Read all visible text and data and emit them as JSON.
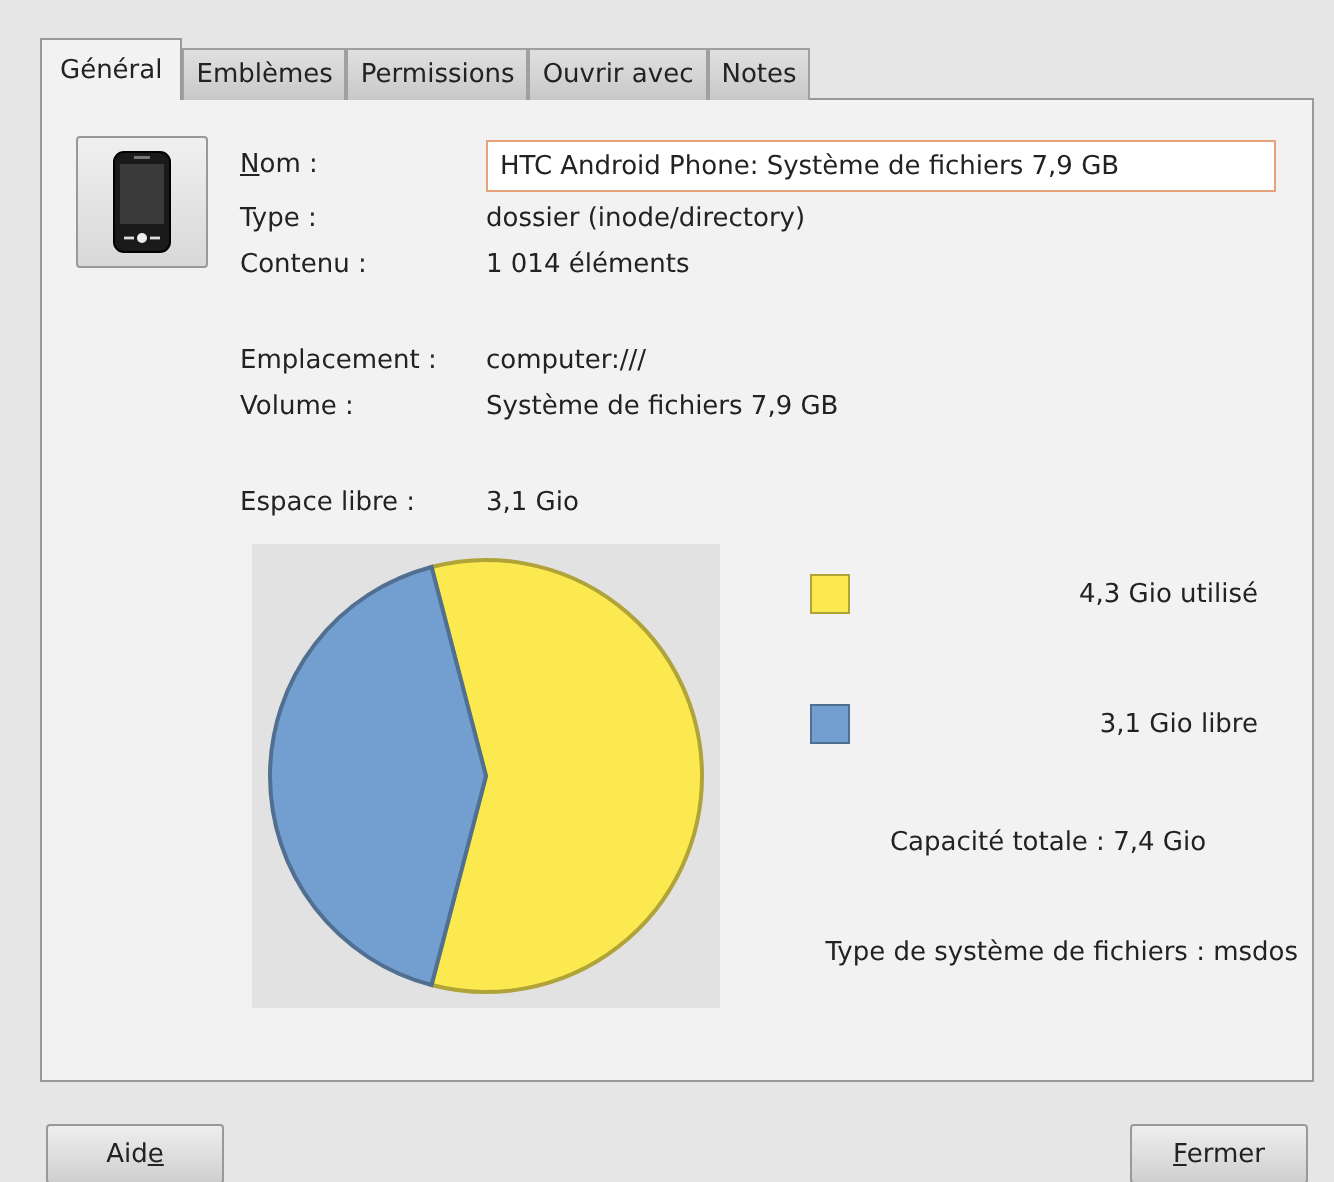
{
  "tabs": [
    {
      "label": "Général",
      "selected": true
    },
    {
      "label": "Emblèmes",
      "selected": false
    },
    {
      "label": "Permissions",
      "selected": false
    },
    {
      "label": "Ouvrir avec",
      "selected": false
    },
    {
      "label": "Notes",
      "selected": false
    }
  ],
  "name_field": {
    "label": {
      "key": "N",
      "after": "om :"
    },
    "value": "HTC Android Phone: Système de fichiers 7,9 GB"
  },
  "info_groups": [
    [
      {
        "label": "Type :",
        "value": "dossier (inode/directory)"
      },
      {
        "label": "Contenu :",
        "value": "1 014 éléments"
      }
    ],
    [
      {
        "label": "Emplacement :",
        "value": "computer:///"
      },
      {
        "label": "Volume :",
        "value": "Système de fichiers 7,9 GB"
      }
    ],
    [
      {
        "label": "Espace libre :",
        "value": "3,1 Gio"
      }
    ]
  ],
  "usage": {
    "chart_data": {
      "type": "pie",
      "categories": [
        "4,3 Gio utilisé",
        "3,1 Gio libre"
      ],
      "values": [
        4.3,
        3.1
      ]
    },
    "legend": [
      {
        "color": "#fce94f"
      },
      {
        "color": "#729fcf"
      }
    ],
    "capacity": "Capacité totale : 7,4 Gio",
    "filesystem": "Type de système de fichiers : msdos"
  },
  "buttons": [
    {
      "label": {
        "before": "Aid",
        "key": "e"
      }
    },
    {
      "label": {
        "key": "F",
        "after": "ermer"
      }
    }
  ]
}
